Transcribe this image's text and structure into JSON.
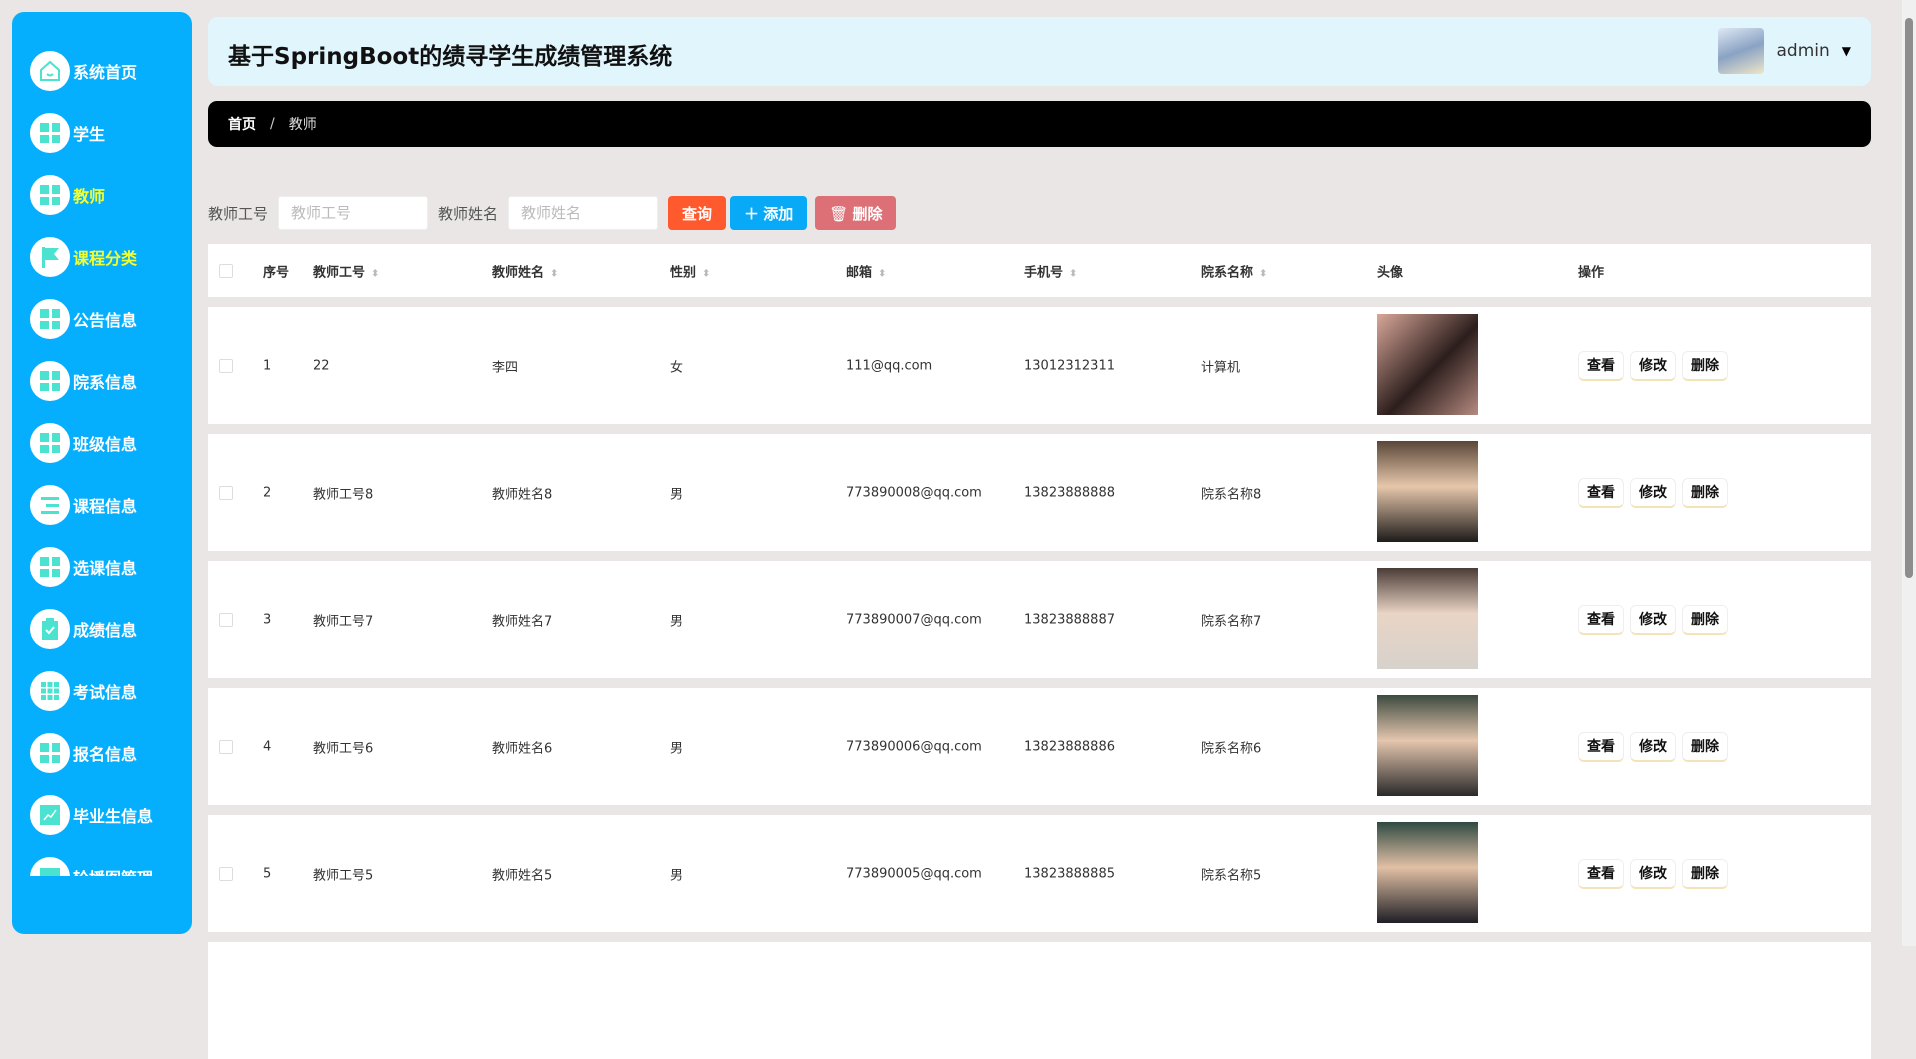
{
  "sidebar": {
    "items": [
      {
        "label": "系统首页",
        "icon": "home-icon"
      },
      {
        "label": "学生",
        "icon": "grid-icon"
      },
      {
        "label": "教师",
        "icon": "grid-icon",
        "highlight": true
      },
      {
        "label": "课程分类",
        "icon": "flag-icon",
        "highlight": true
      },
      {
        "label": "公告信息",
        "icon": "grid-icon"
      },
      {
        "label": "院系信息",
        "icon": "grid-icon"
      },
      {
        "label": "班级信息",
        "icon": "grid-icon"
      },
      {
        "label": "课程信息",
        "icon": "list-icon"
      },
      {
        "label": "选课信息",
        "icon": "grid-icon"
      },
      {
        "label": "成绩信息",
        "icon": "clipboard-check-icon"
      },
      {
        "label": "考试信息",
        "icon": "grid9-icon"
      },
      {
        "label": "报名信息",
        "icon": "grid-icon"
      },
      {
        "label": "毕业生信息",
        "icon": "chart-icon"
      },
      {
        "label": "轮播图管理",
        "icon": "monitor-icon"
      }
    ]
  },
  "header": {
    "title": "基于SpringBoot的绩寻学生成绩管理系统",
    "user": "admin"
  },
  "breadcrumb": {
    "home": "首页",
    "sep": "/",
    "current": "教师"
  },
  "search": {
    "id_label": "教师工号",
    "id_placeholder": "教师工号",
    "name_label": "教师姓名",
    "name_placeholder": "教师姓名",
    "query": "查询",
    "add": "添加",
    "delete": "删除"
  },
  "table": {
    "headers": [
      "序号",
      "教师工号",
      "教师姓名",
      "性别",
      "邮箱",
      "手机号",
      "院系名称",
      "头像",
      "操作"
    ],
    "actions": [
      "查看",
      "修改",
      "删除"
    ],
    "rows": [
      {
        "no": "1",
        "id": "22",
        "name": "李四",
        "gender": "女",
        "email": "111@qq.com",
        "phone": "13012312311",
        "dept": "计算机"
      },
      {
        "no": "2",
        "id": "教师工号8",
        "name": "教师姓名8",
        "gender": "男",
        "email": "773890008@qq.com",
        "phone": "13823888888",
        "dept": "院系名称8"
      },
      {
        "no": "3",
        "id": "教师工号7",
        "name": "教师姓名7",
        "gender": "男",
        "email": "773890007@qq.com",
        "phone": "13823888887",
        "dept": "院系名称7"
      },
      {
        "no": "4",
        "id": "教师工号6",
        "name": "教师姓名6",
        "gender": "男",
        "email": "773890006@qq.com",
        "phone": "13823888886",
        "dept": "院系名称6"
      },
      {
        "no": "5",
        "id": "教师工号5",
        "name": "教师姓名5",
        "gender": "男",
        "email": "773890005@qq.com",
        "phone": "13823888885",
        "dept": "院系名称5"
      }
    ]
  }
}
